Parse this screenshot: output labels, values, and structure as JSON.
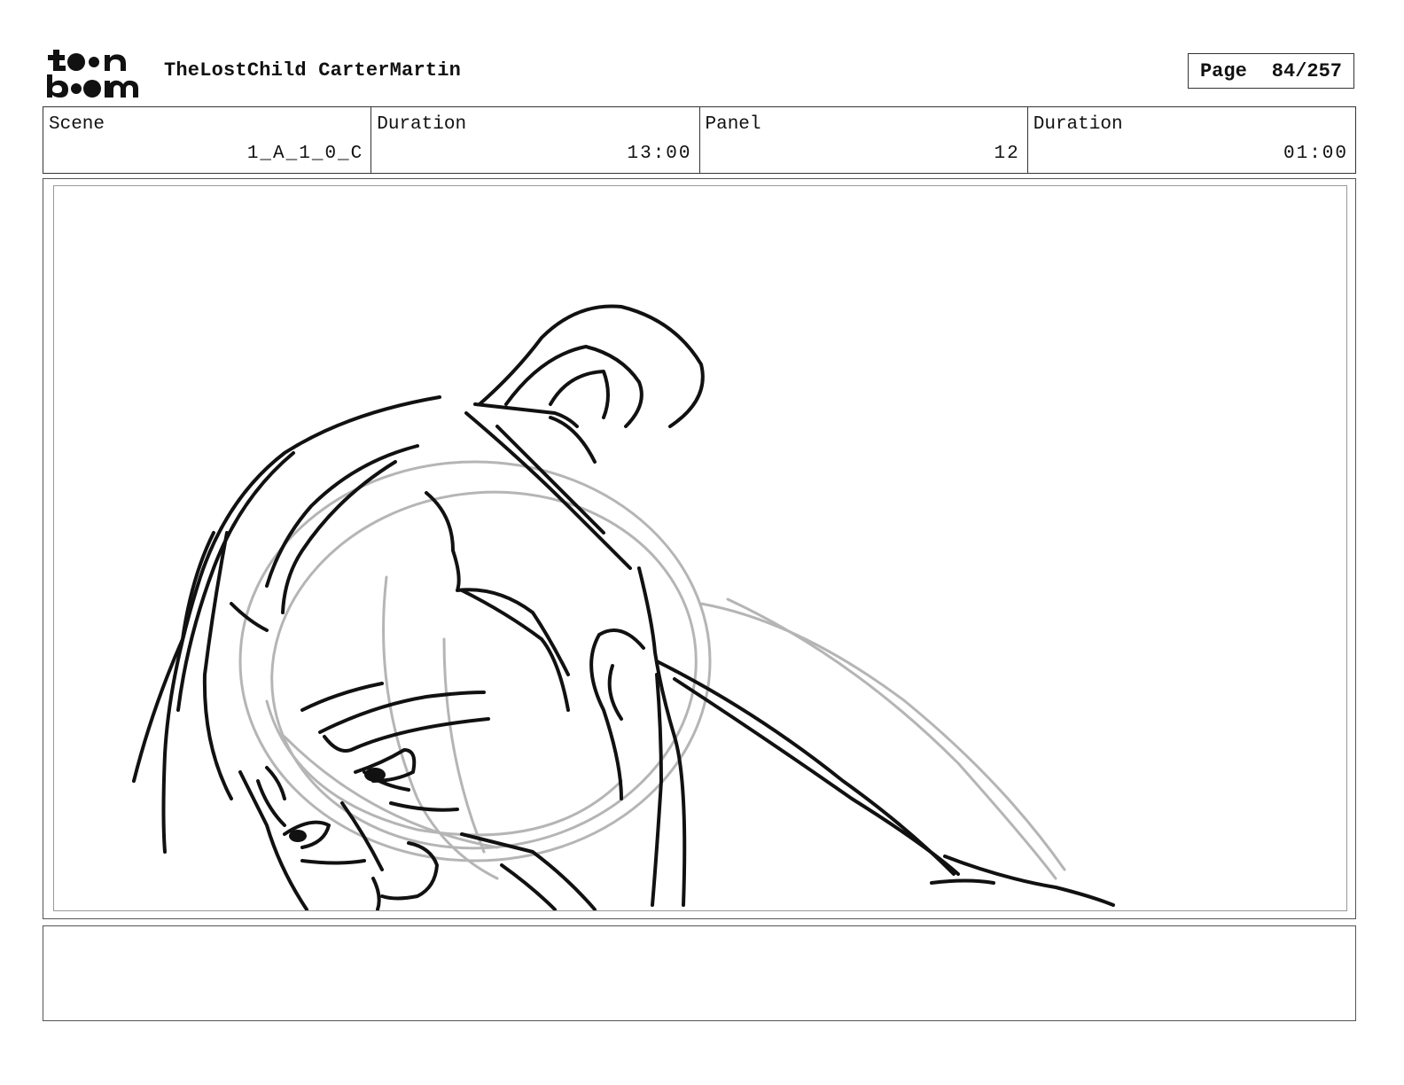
{
  "logo": {
    "line1": "toon",
    "line2": "boom",
    "icon": "toon-boom-logo"
  },
  "header": {
    "project_title": "TheLostChild CarterMartin",
    "page_label": "Page",
    "page_value": "84/257"
  },
  "info": {
    "scene_label": "Scene",
    "scene_value": "1_A_1_0_C",
    "scene_duration_label": "Duration",
    "scene_duration_value": "13:00",
    "panel_label": "Panel",
    "panel_value": "12",
    "panel_duration_label": "Duration",
    "panel_duration_value": "01:00"
  },
  "panel": {
    "image": "sketch-child-looking-down-icon"
  },
  "notes": {
    "text": ""
  },
  "colors": {
    "ink": "#111111",
    "construction": "#b5b5b5",
    "border": "#333333"
  }
}
